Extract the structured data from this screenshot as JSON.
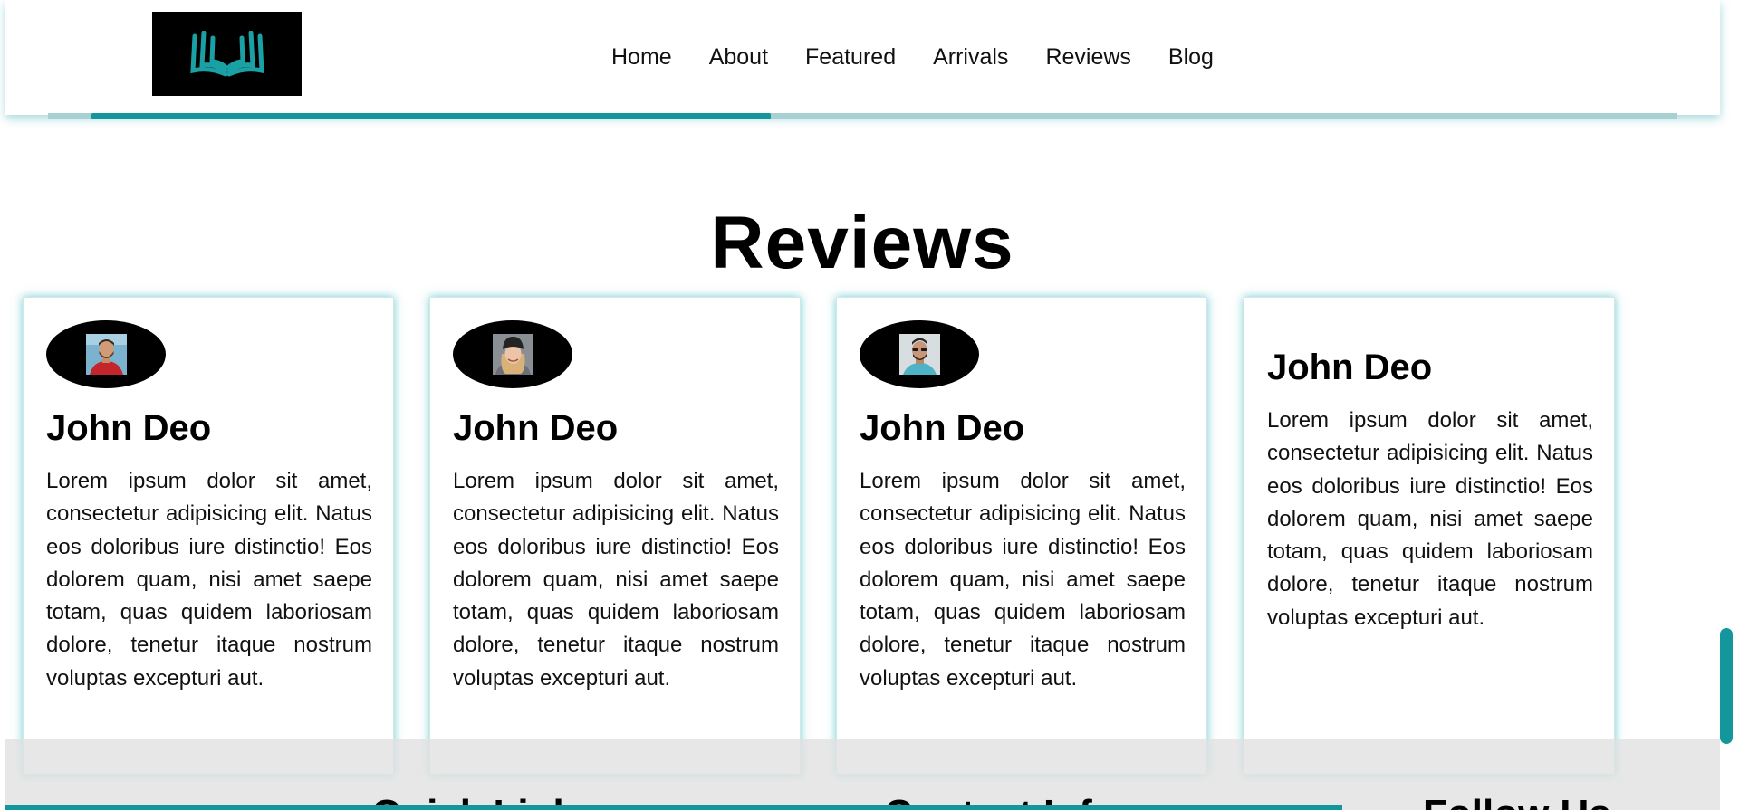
{
  "nav": {
    "items": [
      "Home",
      "About",
      "Featured",
      "Arrivals",
      "Reviews",
      "Blog"
    ]
  },
  "reviews": {
    "title": "Reviews",
    "cards": [
      {
        "name": "John Deo",
        "text": "Lorem ipsum dolor sit amet, consectetur adipisicing elit. Natus eos doloribus iure distinctio! Eos dolorem quam, nisi amet saepe totam, quas quidem laboriosam dolore, tenetur itaque nostrum voluptas excepturi aut."
      },
      {
        "name": "John Deo",
        "text": "Lorem ipsum dolor sit amet, consectetur adipisicing elit. Natus eos doloribus iure distinctio! Eos dolorem quam, nisi amet saepe totam, quas quidem laboriosam dolore, tenetur itaque nostrum voluptas excepturi aut."
      },
      {
        "name": "John Deo",
        "text": "Lorem ipsum dolor sit amet, consectetur adipisicing elit. Natus eos doloribus iure distinctio! Eos dolorem quam, nisi amet saepe totam, quas quidem laboriosam dolore, tenetur itaque nostrum voluptas excepturi aut."
      },
      {
        "name": "John Deo",
        "text": "Lorem ipsum dolor sit amet, consectetur adipisicing elit. Natus eos doloribus iure distinctio! Eos dolorem quam, nisi amet saepe totam, quas quidem laboriosam dolore, tenetur itaque nostrum voluptas excepturi aut."
      }
    ]
  },
  "footer": {
    "headings": [
      "Quick Links",
      "Contact Info",
      "Follow Us"
    ]
  },
  "colors": {
    "accent": "#13969c",
    "accent_light": "#a6d0d1",
    "logo_bg": "#000000",
    "footer_bg": "#e0e0e0"
  },
  "icons": {
    "logo": "open-book-icon"
  }
}
